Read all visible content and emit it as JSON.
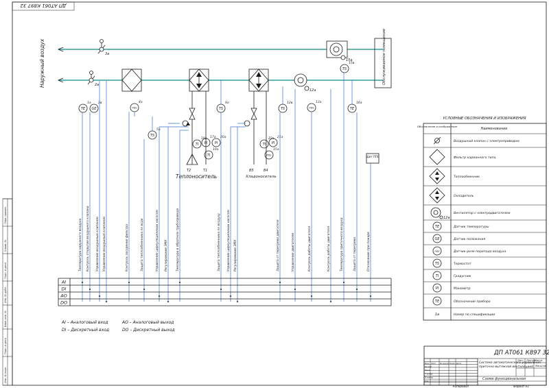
{
  "stamp_rotated": "ДП АТ061 К897 32",
  "outdoor_air_label": "Наружный воздух",
  "served_room_label": "Обслуживаемое помещение",
  "medium_heat": "Теплоноситель",
  "medium_cool": "Хладоноситель",
  "fire_panel_label": "Щит ППС",
  "io_rows": [
    "AI",
    "DI",
    "AO",
    "DO"
  ],
  "io_legend": [
    "AI – Аналоговый вход",
    "AO – Аналоговый выход",
    "DI – Дискретный вход",
    "DO – Дискретный выход"
  ],
  "instruments": [
    {
      "pos": "1а",
      "type": "TE"
    },
    {
      "pos": "2в",
      "type": "GE"
    },
    {
      "pos": "4а",
      "type": "PDS"
    },
    {
      "pos": "5а",
      "type": "TS"
    },
    {
      "pos": "9а",
      "type": "TS"
    },
    {
      "pos": "12в",
      "type": "TS"
    },
    {
      "pos": "13а",
      "type": "PDS"
    },
    {
      "pos": "16а",
      "type": "TE"
    },
    {
      "pos": "17а",
      "type": "PI"
    },
    {
      "pos": "18а",
      "type": "TI"
    },
    {
      "pos": "19а",
      "type": "TI"
    },
    {
      "pos": "20а",
      "type": "PI"
    },
    {
      "pos": "21а",
      "type": "PI"
    },
    {
      "pos": "22а",
      "type": "TI"
    },
    {
      "pos": "15а",
      "type": "PDS"
    },
    {
      "pos": "15в",
      "type": "TS"
    }
  ],
  "pipe_numbers": [
    "Т2",
    "Т1",
    "В5",
    "В4"
  ],
  "signal_labels": [
    "Температура наружного воздуха",
    "Контроль открытия воздушного клапана",
    "Управление воздушным клапаном",
    "Управление воздушным клапаном",
    "Контроль засорения фильтра",
    "Защита теплообменника по воде",
    "Управление циркуляционным насосом",
    "Регулирование ЭМК",
    "Температура в обратном трубопроводе",
    "Защита теплообменника по воздуху",
    "Управление циркуляционным насосом",
    "Регулирование ЭМК",
    "Защита от перегрева двигателя",
    "Управление двигателем",
    "Контроль работы двигателя",
    "Контроль работы двигателя",
    "Температура приточного воздуха",
    "Защита от перегрева",
    "Отключение при пожаре"
  ],
  "legend": {
    "title": "УСЛОВНЫЕ ОБОЗНАЧЕНИЯ И ИЗОБРАЖЕНИЯ",
    "col_symbol": "Обозначение и изображение",
    "col_name": "Наименование",
    "rows": [
      {
        "symbol": "",
        "name": "Воздушный клапан с электроприводом"
      },
      {
        "symbol": "",
        "name": "Фильтр карманного типа"
      },
      {
        "symbol": "",
        "name": "Теплообменник"
      },
      {
        "symbol": "",
        "name": "Охладитель"
      },
      {
        "symbol": "12а",
        "name": "Вентилятор с электродвигателем"
      },
      {
        "symbol": "TE",
        "name": "Датчик температуры"
      },
      {
        "symbol": "GE",
        "name": "Датчик положения"
      },
      {
        "symbol": "PDS",
        "name": "Датчик-реле перепада воздуха"
      },
      {
        "symbol": "TS",
        "name": "Термостат"
      },
      {
        "symbol": "TI",
        "name": "Градусник"
      },
      {
        "symbol": "PI",
        "name": "Манометр"
      },
      {
        "symbol": "TE",
        "name": "Обозначение прибора"
      },
      {
        "symbol": "1а",
        "name": "Номер по спецификации"
      }
    ]
  },
  "title_block": {
    "doc_code": "ДП АТ061 К897 32",
    "subject": "Система автоматического управления приточно-вытяжной вентиляцией",
    "drawing_name": "Схема функциональная",
    "sheet_caption": "Лист",
    "sheets_caption": "Листов",
    "mass_caption": "Масса",
    "scale_caption": "Масштаб",
    "row_labels": [
      "Изм.",
      "Лист",
      "№ докум.",
      "Подп.",
      "Дата",
      "Разраб.",
      "Пров.",
      "Т.контр.",
      "Н.контр.",
      "Утв."
    ],
    "copy_label": "Копировал",
    "format_label": "Формат А3"
  },
  "side_margin": [
    "Перв. примен.",
    "Справ. №",
    "Подп. и дата",
    "Инв. № дубл.",
    "Взам. инв. №",
    "Подп. и дата",
    "Инв. № подл."
  ]
}
